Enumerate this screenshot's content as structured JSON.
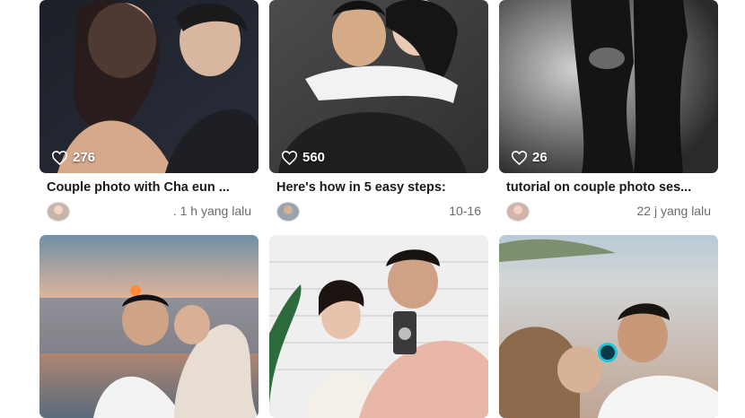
{
  "feed": {
    "cards": [
      {
        "likes": "276",
        "title": "Couple photo with Cha eun ...",
        "time": ". 1 h yang lalu"
      },
      {
        "likes": "560",
        "title": "Here's how in 5 easy steps:",
        "time": "10-16"
      },
      {
        "likes": "26",
        "title": "tutorial on couple photo ses...",
        "time": "22 j yang lalu"
      }
    ]
  },
  "colors": {
    "card_text": "#1a1a1a",
    "meta_text": "#6b6b6b",
    "highlight_ring": "#21c4e0"
  },
  "icons": [
    "heart-icon"
  ]
}
